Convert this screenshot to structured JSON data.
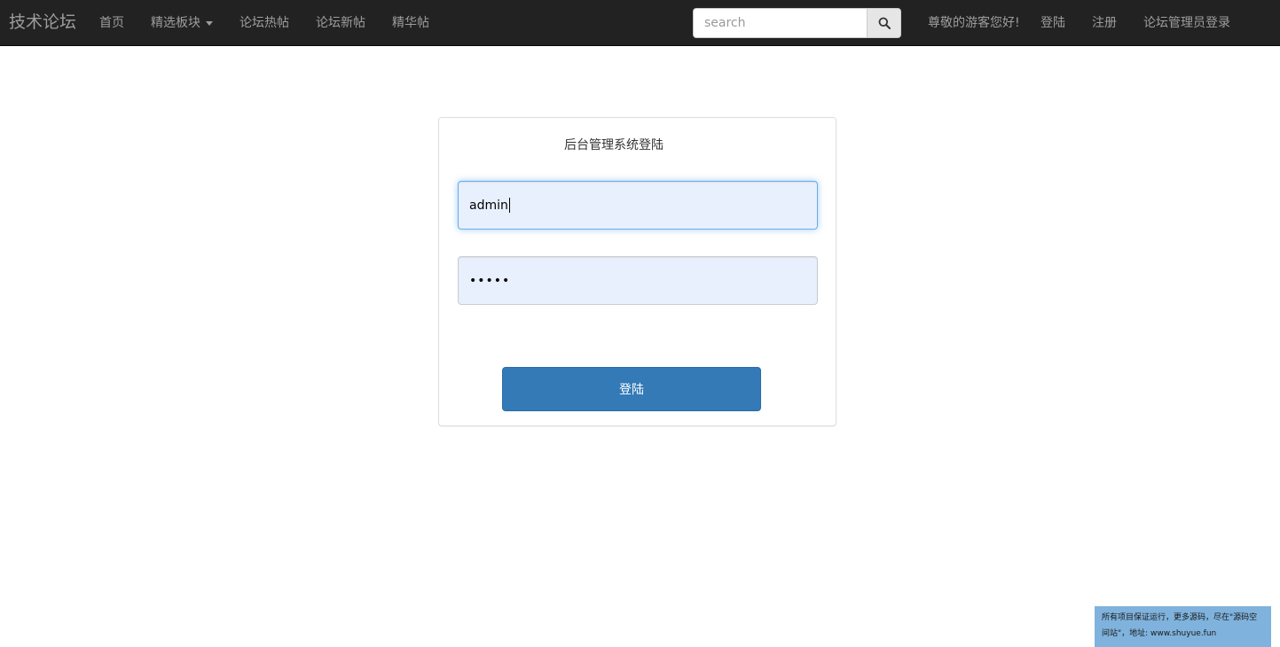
{
  "navbar": {
    "brand": "技术论坛",
    "items": [
      {
        "label": "首页"
      },
      {
        "label": "精选板块"
      },
      {
        "label": "论坛热帖"
      },
      {
        "label": "论坛新帖"
      },
      {
        "label": "精华帖"
      }
    ],
    "search": {
      "placeholder": "search",
      "value": "",
      "icon": "search-icon"
    },
    "greeting": "尊敬的游客您好!",
    "right_links": [
      {
        "label": "登陆"
      },
      {
        "label": "注册"
      },
      {
        "label": "论坛管理员登录"
      }
    ]
  },
  "login": {
    "title": "后台管理系统登陆",
    "username": "admin",
    "password_mask": "•••••",
    "submit_label": "登陆"
  },
  "notice": {
    "text": "所有项目保证运行，更多源码，尽在\"源码空间站\"，地址: www.shuyue.fun"
  },
  "colors": {
    "navbar_bg": "#222222",
    "nav_text": "#9d9d9d",
    "primary_button": "#337ab7",
    "input_bg": "#e8f0fe",
    "notice_bg": "#7fb2dc"
  }
}
